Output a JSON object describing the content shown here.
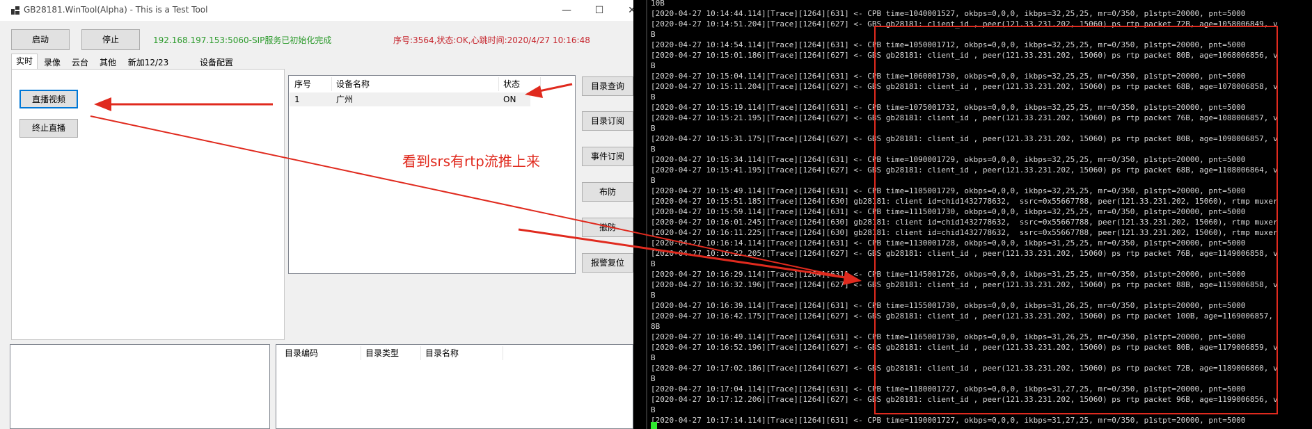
{
  "window": {
    "title": "GB28181.WinTool(Alpha) - This is a Test Tool",
    "controls": {
      "minimize": "—",
      "maximize": "☐",
      "close": "✕"
    }
  },
  "toolbar": {
    "start_label": "启动",
    "stop_label": "停止",
    "sip_status": "192.168.197.153:5060-SIP服务已初始化完成",
    "heartbeat_status": "序号:3564,状态:OK,心跳时间:2020/4/27 10:16:48"
  },
  "tabs": [
    "实时",
    "录像",
    "云台",
    "其他",
    "新加12/23",
    "设备配置"
  ],
  "live": {
    "play_label": "直播视频",
    "stop_label": "终止直播"
  },
  "device_table": {
    "headers": [
      "序号",
      "设备名称",
      "状态"
    ],
    "rows": [
      {
        "index": "1",
        "name": "广州",
        "status": "ON"
      }
    ]
  },
  "side_buttons": [
    "目录查询",
    "目录订阅",
    "事件订阅",
    "布防",
    "撤防",
    "报警复位"
  ],
  "annotation": "看到srs有rtp流推上来",
  "catalog_table": {
    "headers": [
      "目录编码",
      "目录类型",
      "目录名称"
    ]
  },
  "terminal": {
    "lines": [
      "10B",
      "[2020-04-27 10:14:44.114][Trace][1264][631] <- CPB time=1040001527, okbps=0,0,0, ikbps=32,25,25, mr=0/350, p1stpt=20000, pnt=5000",
      "[2020-04-27 10:14:51.204][Trace][1264][627] <- GBS gb28181: client_id , peer(121.33.231.202, 15060) ps rtp packet 72B, age=1058006849, v",
      "B",
      "[2020-04-27 10:14:54.114][Trace][1264][631] <- CPB time=1050001712, okbps=0,0,0, ikbps=32,25,25, mr=0/350, p1stpt=20000, pnt=5000",
      "[2020-04-27 10:15:01.186][Trace][1264][627] <- GBS gb28181: client_id , peer(121.33.231.202, 15060) ps rtp packet 80B, age=1068006856, v",
      "B",
      "[2020-04-27 10:15:04.114][Trace][1264][631] <- CPB time=1060001730, okbps=0,0,0, ikbps=32,25,25, mr=0/350, p1stpt=20000, pnt=5000",
      "[2020-04-27 10:15:11.204][Trace][1264][627] <- GBS gb28181: client_id , peer(121.33.231.202, 15060) ps rtp packet 68B, age=1078006858, v",
      "B",
      "[2020-04-27 10:15:19.114][Trace][1264][631] <- CPB time=1075001732, okbps=0,0,0, ikbps=32,25,25, mr=0/350, p1stpt=20000, pnt=5000",
      "[2020-04-27 10:15:21.195][Trace][1264][627] <- GBS gb28181: client_id , peer(121.33.231.202, 15060) ps rtp packet 76B, age=1088006857, v",
      "B",
      "[2020-04-27 10:15:31.175][Trace][1264][627] <- GBS gb28181: client_id , peer(121.33.231.202, 15060) ps rtp packet 80B, age=1098006857, v",
      "B",
      "[2020-04-27 10:15:34.114][Trace][1264][631] <- CPB time=1090001729, okbps=0,0,0, ikbps=32,25,25, mr=0/350, p1stpt=20000, pnt=5000",
      "[2020-04-27 10:15:41.195][Trace][1264][627] <- GBS gb28181: client_id , peer(121.33.231.202, 15060) ps rtp packet 68B, age=1108006864, v",
      "B",
      "[2020-04-27 10:15:49.114][Trace][1264][631] <- CPB time=1105001729, okbps=0,0,0, ikbps=32,25,25, mr=0/350, p1stpt=20000, pnt=5000",
      "[2020-04-27 10:15:51.185][Trace][1264][630] gb28181: client id=chid1432778632,  ssrc=0x55667788, peer(121.33.231.202, 15060), rtmp muxer",
      "[2020-04-27 10:15:59.114][Trace][1264][631] <- CPB time=1115001730, okbps=0,0,0, ikbps=32,25,25, mr=0/350, p1stpt=20000, pnt=5000",
      "[2020-04-27 10:16:01.245][Trace][1264][630] gb28181: client id=chid1432778632,  ssrc=0x55667788, peer(121.33.231.202, 15060), rtmp muxer",
      "[2020-04-27 10:16:11.225][Trace][1264][630] gb28181: client id=chid1432778632,  ssrc=0x55667788, peer(121.33.231.202, 15060), rtmp muxer",
      "[2020-04-27 10:16:14.114][Trace][1264][631] <- CPB time=1130001728, okbps=0,0,0, ikbps=31,25,25, mr=0/350, p1stpt=20000, pnt=5000",
      "[2020-04-27 10:16:22.205][Trace][1264][627] <- GBS gb28181: client_id , peer(121.33.231.202, 15060) ps rtp packet 76B, age=1149006858, v",
      "B",
      "[2020-04-27 10:16:29.114][Trace][1264][631] <- CPB time=1145001726, okbps=0,0,0, ikbps=31,25,25, mr=0/350, p1stpt=20000, pnt=5000",
      "[2020-04-27 10:16:32.196][Trace][1264][627] <- GBS gb28181: client_id , peer(121.33.231.202, 15060) ps rtp packet 88B, age=1159006858, v",
      "B",
      "[2020-04-27 10:16:39.114][Trace][1264][631] <- CPB time=1155001730, okbps=0,0,0, ikbps=31,26,25, mr=0/350, p1stpt=20000, pnt=5000",
      "[2020-04-27 10:16:42.175][Trace][1264][627] <- GBS gb28181: client_id , peer(121.33.231.202, 15060) ps rtp packet 100B, age=1169006857,",
      "8B",
      "[2020-04-27 10:16:49.114][Trace][1264][631] <- CPB time=1165001730, okbps=0,0,0, ikbps=31,26,25, mr=0/350, p1stpt=20000, pnt=5000",
      "[2020-04-27 10:16:52.196][Trace][1264][627] <- GBS gb28181: client_id , peer(121.33.231.202, 15060) ps rtp packet 80B, age=1179006859, v",
      "B",
      "[2020-04-27 10:17:02.186][Trace][1264][627] <- GBS gb28181: client_id , peer(121.33.231.202, 15060) ps rtp packet 72B, age=1189006860, v",
      "B",
      "[2020-04-27 10:17:04.114][Trace][1264][631] <- CPB time=1180001727, okbps=0,0,0, ikbps=31,27,25, mr=0/350, p1stpt=20000, pnt=5000",
      "[2020-04-27 10:17:12.206][Trace][1264][627] <- GBS gb28181: client_id , peer(121.33.231.202, 15060) ps rtp packet 96B, age=1199006856, v",
      "B",
      "[2020-04-27 10:17:14.114][Trace][1264][631] <- CPB time=1190001727, okbps=0,0,0, ikbps=31,27,25, mr=0/350, p1stpt=20000, pnt=5000"
    ]
  },
  "colors": {
    "sip_status": "#2b9a2b",
    "heartbeat_status": "#c6262e",
    "annotation": "#e02a1e",
    "terminal_bg": "#000000",
    "terminal_text": "#d8d8d8",
    "cursor": "#2ee82e"
  },
  "icons": {
    "app": "app-grid-icon"
  }
}
